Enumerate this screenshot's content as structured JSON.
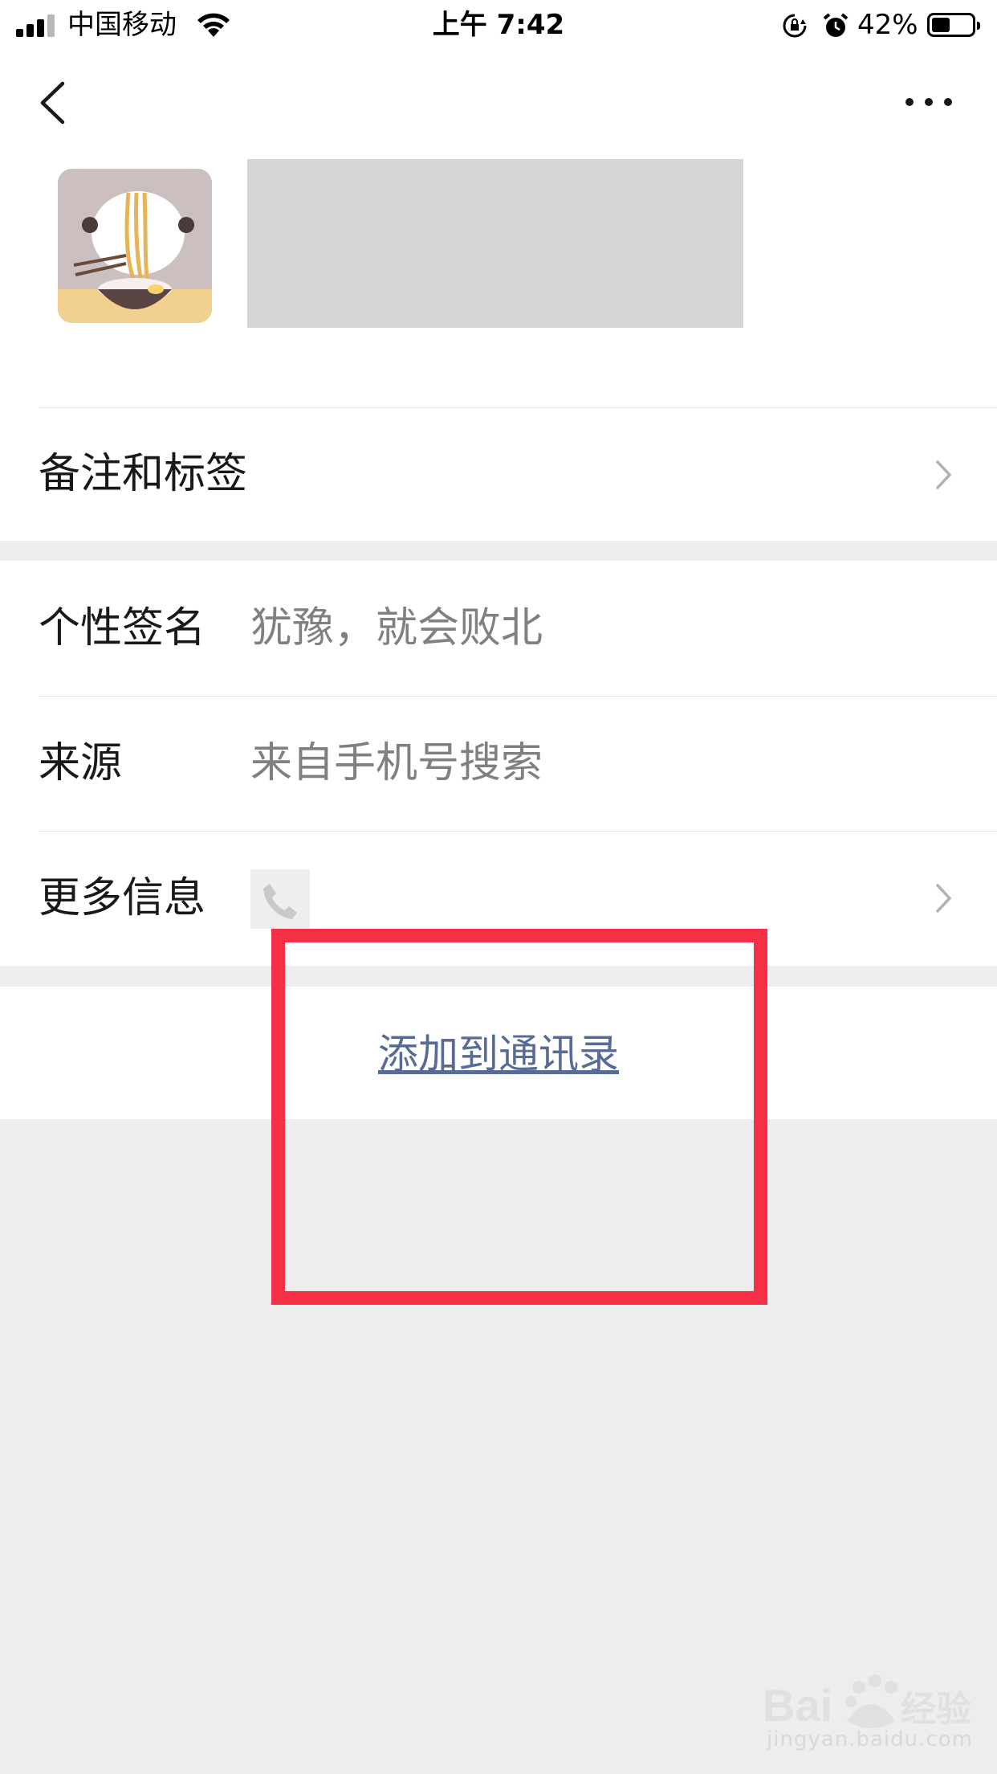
{
  "status_bar": {
    "carrier": "中国移动",
    "time": "上午 7:42",
    "battery_percent": "42%",
    "battery_level": 0.42
  },
  "profile": {
    "remark_tags_label": "备注和标签"
  },
  "info": {
    "signature_label": "个性签名",
    "signature_value": "犹豫，就会败北",
    "source_label": "来源",
    "source_value": "来自手机号搜索",
    "more_info_label": "更多信息"
  },
  "actions": {
    "add_to_contacts": "添加到通讯录"
  },
  "watermark": {
    "brand": "Baidu经验",
    "url": "jingyan.baidu.com"
  },
  "colors": {
    "link": "#576b95",
    "highlight_box": "#f52f45",
    "background": "#ededed"
  }
}
